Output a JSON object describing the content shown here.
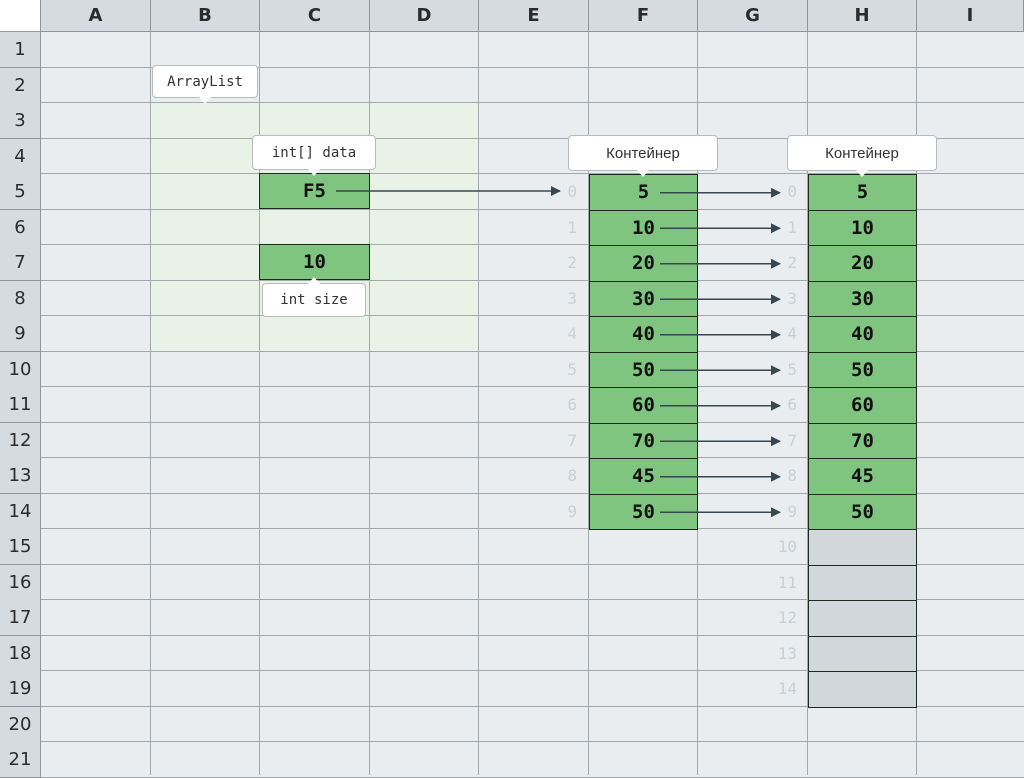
{
  "columns": [
    "A",
    "B",
    "C",
    "D",
    "E",
    "F",
    "G",
    "H",
    "I"
  ],
  "rows": [
    "1",
    "2",
    "3",
    "4",
    "5",
    "6",
    "7",
    "8",
    "9",
    "10",
    "11",
    "12",
    "13",
    "14",
    "15",
    "16",
    "17",
    "18",
    "19",
    "20",
    "21"
  ],
  "arraylist": {
    "label": "ArrayList",
    "data_label": "int[] data",
    "data_ref": "F5",
    "size_label": "int size",
    "size_value": "10"
  },
  "container_old": {
    "label": "Контейнер",
    "values": [
      "5",
      "10",
      "20",
      "30",
      "40",
      "50",
      "60",
      "70",
      "45",
      "50"
    ],
    "indices": [
      "0",
      "1",
      "2",
      "3",
      "4",
      "5",
      "6",
      "7",
      "8",
      "9"
    ]
  },
  "container_new": {
    "label": "Контейнер",
    "values": [
      "5",
      "10",
      "20",
      "30",
      "40",
      "50",
      "60",
      "70",
      "45",
      "50"
    ],
    "indices": [
      "0",
      "1",
      "2",
      "3",
      "4",
      "5",
      "6",
      "7",
      "8",
      "9"
    ],
    "empty_indices": [
      "10",
      "11",
      "12",
      "13",
      "14"
    ]
  },
  "colors": {
    "cell_fill": "#7fc47f",
    "empty_fill": "#d2d7dc",
    "region_fill": "#e7f2e5",
    "arrow": "#37474f"
  }
}
